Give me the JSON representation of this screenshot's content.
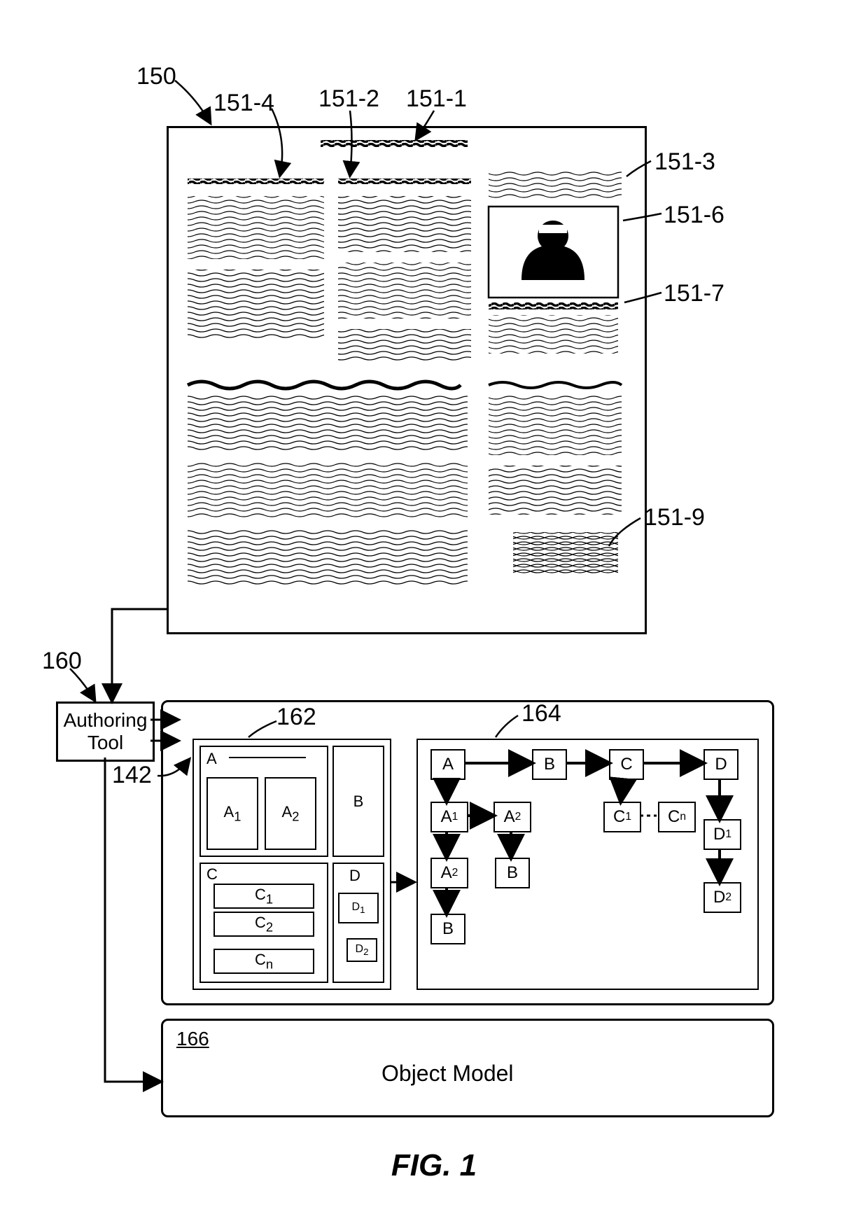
{
  "figure_label": "FIG. 1",
  "callouts": {
    "c150": "150",
    "c151_1": "151-1",
    "c151_2": "151-2",
    "c151_3": "151-3",
    "c151_4": "151-4",
    "c151_6": "151-6",
    "c151_7": "151-7",
    "c151_9": "151-9",
    "c160": "160",
    "c142": "142",
    "c162": "162",
    "c164": "164",
    "c166": "166"
  },
  "authoring_tool_label": "Authoring\nTool",
  "object_model_label": "Object Model",
  "layout162": {
    "A": "A",
    "A1": "A",
    "A1sub": "1",
    "A2": "A",
    "A2sub": "2",
    "B": "B",
    "C": "C",
    "C1": "C",
    "C1sub": "1",
    "C2": "C",
    "C2sub": "2",
    "Cn": "C",
    "Cnsub": "n",
    "D": "D",
    "D1": "D",
    "D1sub": "1",
    "D2": "D",
    "D2sub": "2"
  },
  "graph164": {
    "A": "A",
    "A1": "A",
    "A1sub": "1",
    "A2a": "A",
    "A2asub": "2",
    "A2b": "A",
    "A2bsub": "2",
    "Ba": "B",
    "Bb": "B",
    "Bc": "B",
    "C": "C",
    "C1": "C",
    "C1sub": "1",
    "Cn": "C",
    "Cnsub": "n",
    "D": "D",
    "D1": "D",
    "D1sub": "1",
    "D2": "D",
    "D2sub": "2"
  }
}
